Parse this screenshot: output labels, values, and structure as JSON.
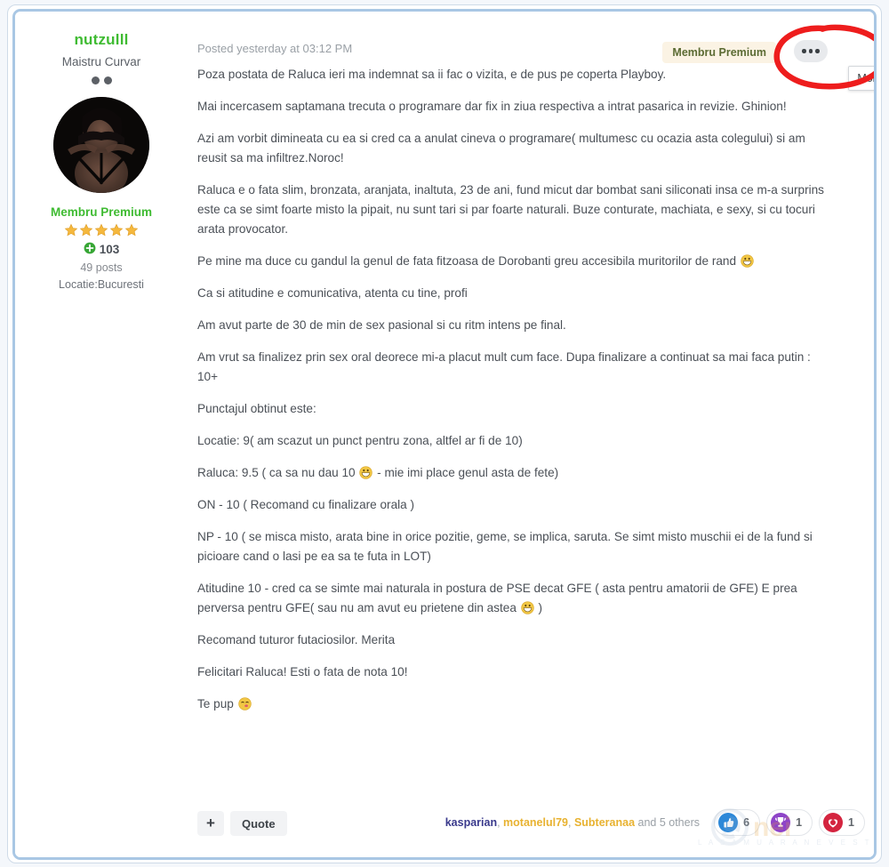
{
  "author": {
    "name": "nutzulll",
    "rank_title": "Maistru Curvar",
    "rank_pips": 2,
    "group": "Membru Premium",
    "stars": 5,
    "reputation": "103",
    "post_count": "49 posts",
    "location": "Locatie:Bucuresti",
    "avatar_alt": "user-avatar"
  },
  "post": {
    "date": "Posted yesterday at 03:12 PM",
    "badge": "Membru Premium",
    "more_options_tooltip": "More options...",
    "paragraphs": [
      "Poza postata de Raluca ieri ma indemnat sa ii fac o vizita, e de pus pe coperta Playboy.",
      "Mai incercasem saptamana trecuta o programare dar fix in ziua respectiva a intrat pasarica in revizie. Ghinion!",
      "Azi am vorbit dimineata cu ea si cred ca a anulat cineva o programare( multumesc cu ocazia asta colegului) si am reusit sa ma infiltrez.Noroc!",
      "Raluca e o fata slim, bronzata, aranjata, inaltuta, 23 de ani, fund micut dar bombat sani siliconati insa ce m-a surprins este ca se simt foarte misto la pipait, nu sunt tari si par  foarte naturali. Buze conturate, machiata, e sexy, si cu tocuri arata provocator.",
      "Pe mine ma duce cu gandul la genul de fata fitzoasa de Dorobanti greu accesibila muritorilor de rand ",
      "Ca si atitudine e comunicativa, atenta cu tine, profi",
      "Am avut parte de 30 de min de sex pasional si cu ritm intens pe final.",
      "Am vrut sa finalizez prin sex oral deorece mi-a placut mult cum face. Dupa finalizare a continuat sa mai faca putin : 10+",
      "Punctajul obtinut este:",
      "Locatie: 9( am scazut un punct pentru zona, altfel ar fi de 10)",
      "Raluca: 9.5 ( ca sa nu dau 10 ",
      " - mie imi place genul asta de fete)",
      "ON - 10 ( Recomand cu finalizare orala )",
      "NP - 10 ( se misca misto, arata bine in orice pozitie, geme, se implica, saruta. Se simt misto muschii ei de la fund si picioare cand o lasi pe ea sa te futa in LOT)",
      "Atitudine 10 - cred ca se simte mai naturala in postura de PSE decat GFE ( asta pentru amatorii de GFE) E prea perversa pentru GFE( sau nu am avut eu prietene din astea ",
      " )",
      "Recomand tuturor futaciosilor. Merita",
      "Felicitari Raluca! Esti o fata de nota 10!",
      "Te pup "
    ]
  },
  "footer": {
    "add_label": "+",
    "quote_label": "Quote",
    "reactors": [
      {
        "name": "kasparian",
        "color": "blue"
      },
      {
        "name": "motanelul79",
        "color": "gold"
      },
      {
        "name": "Subteranaa",
        "color": "gold"
      }
    ],
    "reactors_separator": ", ",
    "reactors_suffix": " and 5 others",
    "reactions": [
      {
        "icon": "thumbs-up-icon",
        "count": "6",
        "color": "#2d88d8"
      },
      {
        "icon": "trophy-icon",
        "count": "1",
        "color": "#8e44c8"
      },
      {
        "icon": "heart-icon",
        "count": "1",
        "color": "#d4243f"
      }
    ]
  },
  "watermark": {
    "text": "L A   S A   M U A R A   N E V E S T E L E"
  },
  "colors": {
    "username": "#3fbb32",
    "group": "#3fbb32",
    "frame_border": "#a9c7e4",
    "annotation": "#ee1d1d",
    "body_text": "#4b5057",
    "badge_bg": "#fbf3e4"
  }
}
